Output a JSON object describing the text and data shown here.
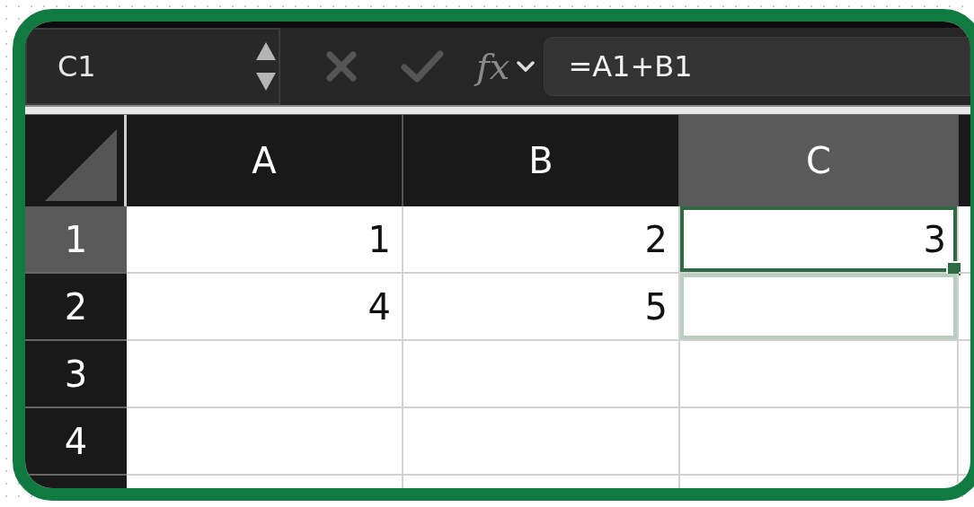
{
  "name_box": {
    "value": "C1"
  },
  "function_button": {
    "label": "fx"
  },
  "formula_field": {
    "value": "=A1+B1"
  },
  "columns": [
    {
      "label": "A",
      "selected": false
    },
    {
      "label": "B",
      "selected": false
    },
    {
      "label": "C",
      "selected": true
    }
  ],
  "rows": [
    {
      "label": "1",
      "selected": true,
      "cells": [
        {
          "value": "1",
          "selected": false,
          "hinted": false
        },
        {
          "value": "2",
          "selected": false,
          "hinted": false
        },
        {
          "value": "3",
          "selected": true,
          "hinted": false
        }
      ]
    },
    {
      "label": "2",
      "selected": false,
      "cells": [
        {
          "value": "4",
          "selected": false,
          "hinted": false
        },
        {
          "value": "5",
          "selected": false,
          "hinted": false
        },
        {
          "selected": false,
          "hinted": true
        }
      ]
    },
    {
      "label": "3",
      "selected": false,
      "cells": [
        {
          "selected": false,
          "hinted": false
        },
        {
          "selected": false,
          "hinted": false
        },
        {
          "selected": false,
          "hinted": false
        }
      ]
    },
    {
      "label": "4",
      "selected": false,
      "cells": [
        {
          "selected": false,
          "hinted": false
        },
        {
          "selected": false,
          "hinted": false
        },
        {
          "selected": false,
          "hinted": false
        }
      ]
    }
  ]
}
